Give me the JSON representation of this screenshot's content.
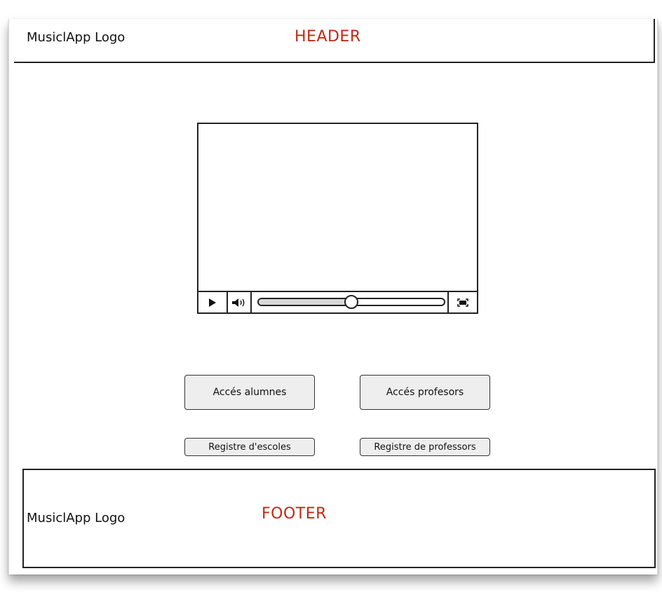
{
  "header": {
    "logo": "MusiclApp Logo",
    "label": "HEADER"
  },
  "video_player": {
    "play_icon": "play-icon",
    "volume_icon": "volume-icon",
    "fullscreen_icon": "fullscreen-icon",
    "progress": 0.5
  },
  "buttons": {
    "students_access": "Accés alumnes",
    "teachers_access": "Accés profesors",
    "schools_register": "Registre d'escoles",
    "teachers_register": "Registre de professors"
  },
  "footer": {
    "logo": "MusiclApp Logo",
    "label": "FOOTER"
  },
  "colors": {
    "section_label": "#c02a12",
    "button_bg": "#eeeeee",
    "border": "#222222"
  }
}
